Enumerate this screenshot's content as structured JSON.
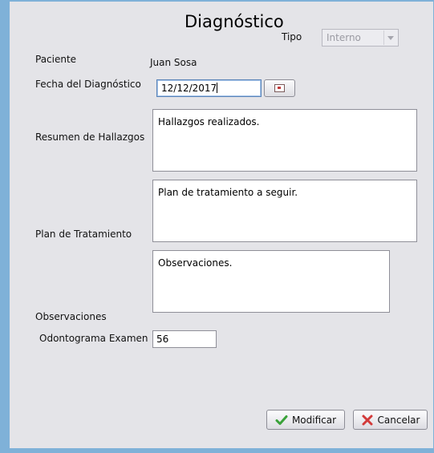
{
  "window": {
    "title": "Diagnóstico"
  },
  "tipo": {
    "label": "Tipo",
    "value": "Interno"
  },
  "paciente": {
    "label": "Paciente",
    "value": "Juan Sosa"
  },
  "fecha": {
    "label": "Fecha del Diagnóstico",
    "value": "12/12/2017"
  },
  "resumen": {
    "label": "Resumen de Hallazgos",
    "value": "Hallazgos realizados."
  },
  "plan": {
    "label": "Plan de Tratamiento",
    "value": "Plan de tratamiento a seguir."
  },
  "observaciones": {
    "label": "Observaciones",
    "value": "Observaciones."
  },
  "odontograma": {
    "label": "Odontograma Examen",
    "value": "56"
  },
  "buttons": {
    "modificar": "Modificar",
    "cancelar": "Cancelar"
  },
  "colors": {
    "accent_frame": "#7fb1d8",
    "panel_bg": "#e4e4e8",
    "ok_green": "#3aa23a",
    "cancel_red": "#d23a3a"
  }
}
